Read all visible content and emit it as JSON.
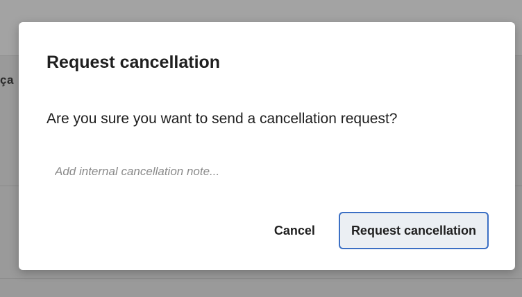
{
  "background": {
    "fragment_text": "ça"
  },
  "dialog": {
    "title": "Request cancellation",
    "message": "Are you sure you want to send a cancellation request?",
    "note_input": {
      "placeholder": "Add internal cancellation note...",
      "value": ""
    },
    "cancel_label": "Cancel",
    "confirm_label": "Request cancellation"
  },
  "colors": {
    "overlay": "#9a9a9a",
    "dialog_bg": "#ffffff",
    "primary_border": "#3b6fc4",
    "primary_bg": "#ebeff3"
  }
}
